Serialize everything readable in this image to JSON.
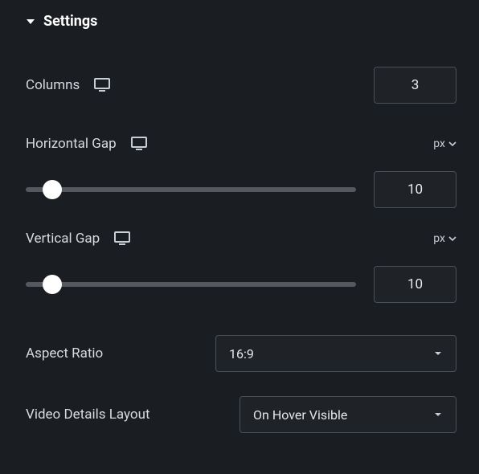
{
  "section": {
    "title": "Settings"
  },
  "columns": {
    "label": "Columns",
    "value": "3"
  },
  "hgap": {
    "label": "Horizontal Gap",
    "unit": "px",
    "value": "10",
    "percent": 8
  },
  "vgap": {
    "label": "Vertical Gap",
    "unit": "px",
    "value": "10",
    "percent": 8
  },
  "aspect": {
    "label": "Aspect Ratio",
    "value": "16:9"
  },
  "details": {
    "label": "Video Details Layout",
    "value": "On Hover Visible"
  }
}
